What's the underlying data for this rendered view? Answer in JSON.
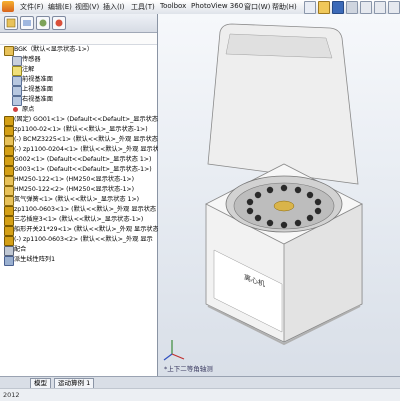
{
  "menu": {
    "items": [
      "文件(F)",
      "编辑(E)",
      "视图(V)",
      "插入(I)",
      "工具(T)",
      "Toolbox",
      "PhotoView 360",
      "窗口(W)",
      "帮助(H)"
    ]
  },
  "tree": {
    "root": "BGK（默认<显示状态-1>）",
    "items": [
      "传感器",
      "注解",
      "前视基准面",
      "上视基准面",
      "右视基准面",
      "原点",
      "(固定) GO01<1> (Default<<Default>_显示状态",
      "zp1100-02<1> (默认<<默认>_显示状态-1>)",
      "(-) BCMZ3225<1> (默认<<默认>_外观 显示状态",
      "(-) zp1100-0204<1> (默认<<默认>_外观 显示状",
      "G002<1> (Default<<Default>_显示状态 1>)",
      "G003<1> (Default<<Default>_显示状态-1>)",
      "HM250-122<1> (HM250<显示状态-1>)",
      "HM250-122<2> (HM250<显示状态-1>)",
      "氮气弹簧<1> (默认<<默认>_显示状态 1>)",
      "zp1100-0603<1> (默认<<默认>_外观 显示状态",
      "三芯插座3<1> (默认<<默认>_显示状态-1>)",
      "船形开关21*29<1> (默认<<默认>_外观 显示状态",
      "(-) zp1100-0603<2> (默认<<默认>_外观 显示",
      "配合",
      "派生线性阵列1"
    ]
  },
  "viewport": {
    "label_text": "离心机",
    "view_name": "*上下二等角轴测"
  },
  "bottom_tabs": [
    "模型",
    "运动算例 1"
  ],
  "status": "2012",
  "colors": {
    "accent": "#2a5aa8",
    "folder": "#e8c25a",
    "part": "#d4a017"
  }
}
